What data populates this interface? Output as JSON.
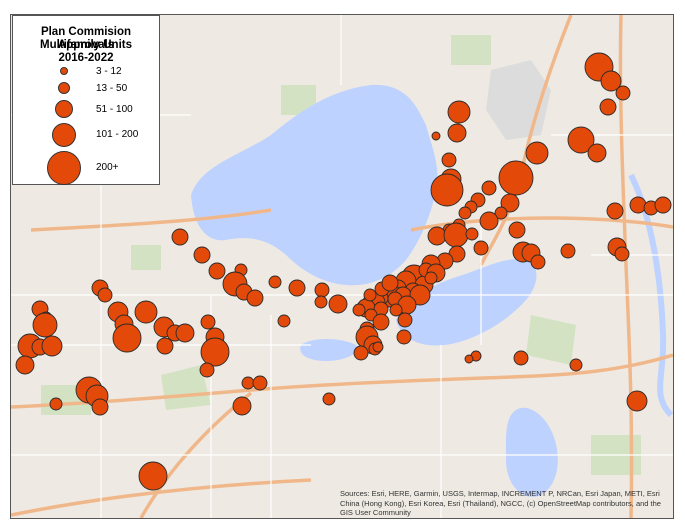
{
  "legend": {
    "title_line1": "Plan Commision Approvals",
    "title_line2": "Multifamily Units",
    "title_line3": "2016-2022",
    "items": [
      {
        "label": "3 - 12"
      },
      {
        "label": "13 - 50"
      },
      {
        "label": "51 - 100"
      },
      {
        "label": "101 - 200"
      },
      {
        "label": "200+"
      }
    ]
  },
  "attribution": "Sources: Esri, HERE, Garmin, USGS, Intermap, INCREMENT P, NRCan, Esri Japan, METI, Esri China (Hong Kong), Esri Korea, Esri (Thailand), NGCC, (c) OpenStreetMap contributors, and the GIS User Community",
  "colors": {
    "symbol": "#e34a0a",
    "water": "#bed2ff",
    "land": "#eeeae3",
    "parks": "#d4e2c4",
    "highway": "#f0b88a"
  },
  "markers": [
    {
      "size_class": "200+"
    }
  ]
}
